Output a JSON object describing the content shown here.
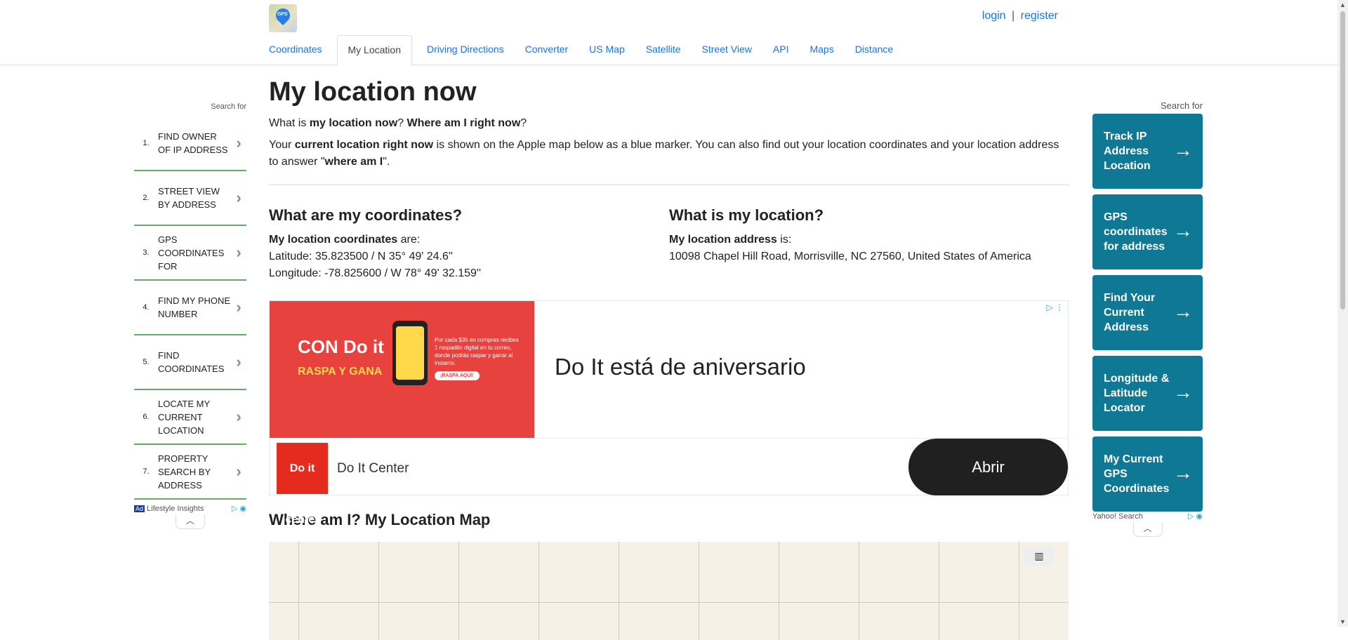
{
  "header": {
    "logo_text": "GPS",
    "login": "login",
    "separator": "|",
    "register": "register",
    "tabs": [
      {
        "label": "Coordinates"
      },
      {
        "label": "My Location",
        "active": true
      },
      {
        "label": "Driving Directions"
      },
      {
        "label": "Converter"
      },
      {
        "label": "US Map"
      },
      {
        "label": "Satellite"
      },
      {
        "label": "Street View"
      },
      {
        "label": "API"
      },
      {
        "label": "Maps"
      },
      {
        "label": "Distance"
      }
    ]
  },
  "left_sidebar": {
    "search_for": "Search for",
    "items": [
      {
        "num": "1.",
        "text": "FIND OWNER OF IP ADDRESS"
      },
      {
        "num": "2.",
        "text": "STREET VIEW BY ADDRESS"
      },
      {
        "num": "3.",
        "text": "GPS COORDINATES FOR"
      },
      {
        "num": "4.",
        "text": "FIND MY PHONE NUMBER"
      },
      {
        "num": "5.",
        "text": "FIND COORDINATES"
      },
      {
        "num": "6.",
        "text": "LOCATE MY CURRENT LOCATION"
      },
      {
        "num": "7.",
        "text": "PROPERTY SEARCH BY ADDRESS"
      }
    ],
    "ad_badge": "Ad",
    "ad_source": "Lifestyle Insights"
  },
  "main": {
    "title": "My location now",
    "intro_q_prefix": "What is ",
    "intro_q_b1": "my location now",
    "intro_q_mid": "? ",
    "intro_q_b2": "Where am I right now",
    "intro_q_suffix": "?",
    "intro2_a": "Your ",
    "intro2_b": "current location right now",
    "intro2_c": " is shown on the Apple map below as a blue marker. You can also find out your location coordinates and your location address to answer \"",
    "intro2_d": "where am I",
    "intro2_e": "\".",
    "coords": {
      "heading": "What are my coordinates?",
      "label_bold": "My location coordinates",
      "label_rest": " are:",
      "latitude": "Latitude: 35.823500 / N 35° 49' 24.6''",
      "longitude": "Longitude: -78.825600 / W 78° 49' 32.159''"
    },
    "location": {
      "heading": "What is my location?",
      "label_bold": "My location address",
      "label_rest": " is:",
      "address": "10098 Chapel Hill Road, Morrisville, NC 27560, United States of America"
    },
    "ad": {
      "image_brand": "CON Do it",
      "image_brand2": "RASPA Y GANA",
      "image_small": "Por cada $35 en compras recibes 1 raspadito digital en tu correo, donde podrás raspar y ganar al instante.",
      "image_cta": "¡RASPA AQUÍ!",
      "headline": "Do It está de aniversario",
      "logo_text": "Do it center",
      "advertiser": "Do It Center",
      "button": "Abrir"
    },
    "map_heading": "Where am I? My Location Map"
  },
  "right_sidebar": {
    "search_for": "Search for",
    "items": [
      {
        "text": "Track IP Address Location"
      },
      {
        "text": "GPS coordinates for address"
      },
      {
        "text": "Find Your Current Address"
      },
      {
        "text": "Longitude & Latitude Locator"
      },
      {
        "text": "My Current GPS Coordinates"
      }
    ],
    "ad_source": "Yahoo! Search"
  },
  "colors": {
    "link": "#1a73e8",
    "sidebar_accent": "#6aa56a",
    "right_button": "#0f7895",
    "ad_red": "#e8423f"
  }
}
